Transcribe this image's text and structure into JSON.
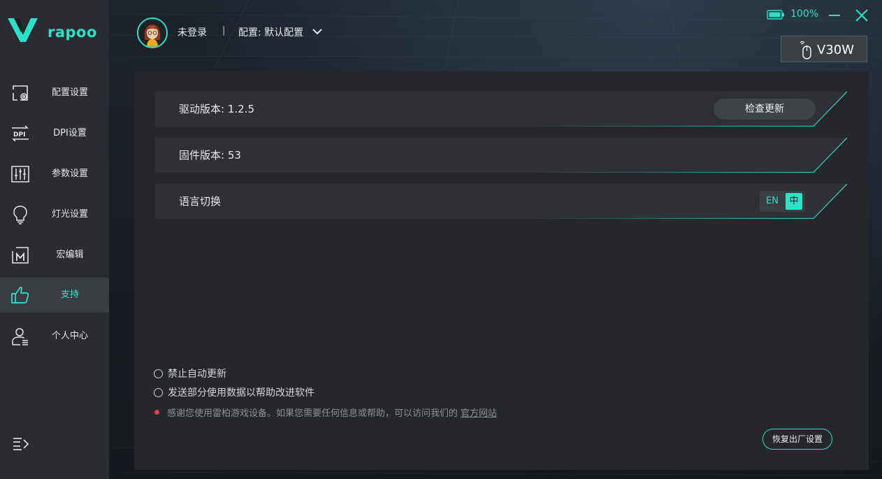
{
  "brand": {
    "logo_text": "rapoo"
  },
  "sidebar": {
    "items": [
      {
        "label": "配置设置",
        "icon": "config-icon"
      },
      {
        "label": "DPI设置",
        "icon": "dpi-icon"
      },
      {
        "label": "参数设置",
        "icon": "sliders-icon"
      },
      {
        "label": "灯光设置",
        "icon": "lightbulb-icon"
      },
      {
        "label": "宏编辑",
        "icon": "macro-icon"
      },
      {
        "label": "支持",
        "icon": "thumbs-up-icon",
        "active": true
      },
      {
        "label": "个人中心",
        "icon": "user-icon"
      }
    ],
    "menu_icon": "menu-toggle-icon"
  },
  "header": {
    "login_status": "未登录",
    "separator": "|",
    "profile_label": "配置: 默认配置",
    "battery_percent": "100%",
    "device_name": "V30W"
  },
  "support": {
    "driver_version_label": "驱动版本: 1.2.5",
    "check_update_label": "检查更新",
    "firmware_version_label": "固件版本: 53",
    "language_label": "语言切换",
    "lang_en": "EN",
    "lang_zh": "中",
    "selected_language": "中"
  },
  "options": {
    "disable_auto_update": "禁止自动更新",
    "send_usage_data": "发送部分使用数据以帮助改进软件",
    "notice_text": "感谢您使用雷柏游戏设备。如果您需要任何信息或帮助，可以访问我们的",
    "official_site_link": "官方网站",
    "reset_button": "恢复出厂设置"
  },
  "colors": {
    "accent": "#2fe0c9",
    "sidebar_bg": "#2a2c31",
    "panel_bg": "#25272b",
    "notice_dot": "#e0413f"
  }
}
